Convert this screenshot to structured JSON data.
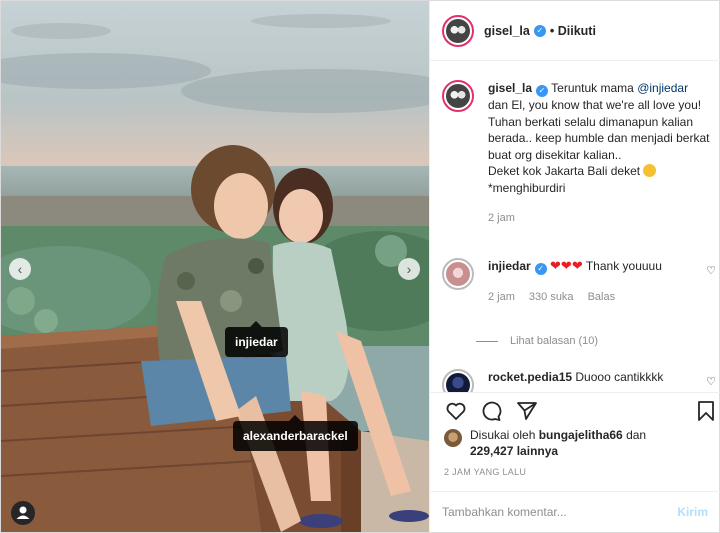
{
  "header": {
    "username": "gisel_la",
    "follow_state": "• Diikuti"
  },
  "caption": {
    "username": "gisel_la",
    "text_before_mention": "Teruntuk mama ",
    "mention": "@injiedar",
    "text_line2": "dan El, you know that we're all love you!",
    "text_line3": "Tuhan berkati selalu dimanapun kalian berada.. keep humble dan menjadi berkat buat org disekitar kalian..",
    "text_line4": "Deket kok Jakarta Bali deket",
    "text_line5": "*menghiburdiri",
    "time": "2 jam"
  },
  "comments": [
    {
      "username": "injiedar",
      "text": "Thank youuuu",
      "time": "2 jam",
      "likes": "330 suka",
      "reply": "Balas",
      "view_replies": "Lihat balasan (10)"
    },
    {
      "username": "rocket.pedia15",
      "text": "Duooo cantikkkk"
    }
  ],
  "photo_tags": [
    "injiedar",
    "alexanderbarackel"
  ],
  "likes": {
    "prefix": "Disukai oleh ",
    "user": "bungajelitha66",
    "and": " dan",
    "count": "229,427",
    "suffix": " lainnya"
  },
  "time_ago": "2 JAM YANG LALU",
  "add_comment": {
    "placeholder": "Tambahkan komentar...",
    "post_label": "Kirim"
  },
  "icons": {
    "verified": "verified-badge",
    "like": "heart-icon",
    "comment": "comment-icon",
    "share": "share-icon",
    "save": "bookmark-icon",
    "nav_prev": "chevron-left-icon",
    "nav_next": "chevron-right-icon",
    "tagged_users": "user-icon"
  }
}
